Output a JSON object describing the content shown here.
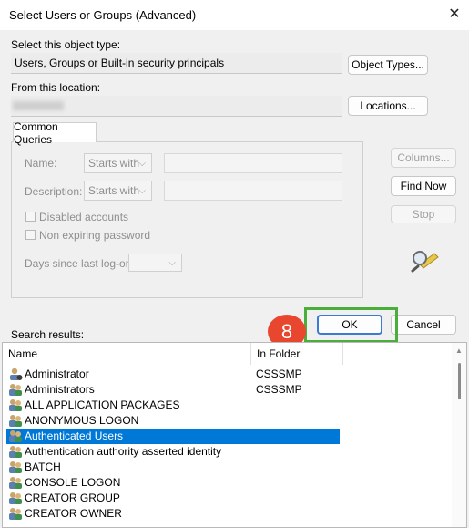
{
  "window": {
    "title": "Select Users or Groups (Advanced)",
    "close_glyph": "✕"
  },
  "object_type": {
    "label": "Select this object type:",
    "value": "Users, Groups or Built-in security principals",
    "button": "Object Types..."
  },
  "location": {
    "label": "From this location:",
    "value": "",
    "button": "Locations..."
  },
  "queries": {
    "tab": "Common Queries",
    "name_label": "Name:",
    "description_label": "Description:",
    "starts_with": "Starts with",
    "disabled_accounts": "Disabled accounts",
    "non_expiring_password": "Non expiring password",
    "days_label": "Days since last log-on:"
  },
  "side_buttons": {
    "columns": "Columns...",
    "find_now": "Find Now",
    "stop": "Stop"
  },
  "search_results_label": "Search results:",
  "ok_button": "OK",
  "cancel_button": "Cancel",
  "annotation_badge": "8",
  "columns": {
    "name": "Name",
    "folder": "In Folder"
  },
  "results": [
    {
      "name": "Administrator",
      "folder": "CSSSMP",
      "icon": "user-icon"
    },
    {
      "name": "Administrators",
      "folder": "CSSSMP",
      "icon": "group-icon"
    },
    {
      "name": "ALL APPLICATION PACKAGES",
      "folder": "",
      "icon": "group-icon"
    },
    {
      "name": "ANONYMOUS LOGON",
      "folder": "",
      "icon": "group-icon"
    },
    {
      "name": "Authenticated Users",
      "folder": "",
      "icon": "group-icon",
      "selected": true
    },
    {
      "name": "Authentication authority asserted identity",
      "folder": "",
      "icon": "group-icon"
    },
    {
      "name": "BATCH",
      "folder": "",
      "icon": "group-icon"
    },
    {
      "name": "CONSOLE LOGON",
      "folder": "",
      "icon": "group-icon"
    },
    {
      "name": "CREATOR GROUP",
      "folder": "",
      "icon": "group-icon"
    },
    {
      "name": "CREATOR OWNER",
      "folder": "",
      "icon": "group-icon"
    }
  ],
  "colors": {
    "selection": "#0078d7",
    "highlight_border": "#4aaf3a",
    "badge": "#e8462f"
  }
}
